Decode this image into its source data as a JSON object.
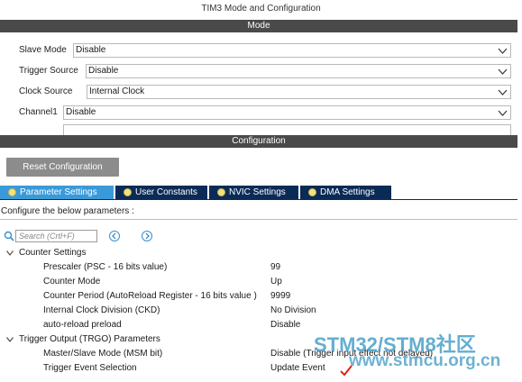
{
  "window": {
    "title": "TIM3 Mode and Configuration"
  },
  "mode_section": {
    "header": "Mode",
    "fields": [
      {
        "label": "Slave Mode",
        "value": "Disable"
      },
      {
        "label": "Trigger Source",
        "value": "Disable"
      },
      {
        "label": "Clock Source",
        "value": "Internal Clock"
      },
      {
        "label": "Channel1",
        "value": "Disable"
      }
    ]
  },
  "config_section": {
    "header": "Configuration",
    "reset_button": "Reset Configuration",
    "tabs": [
      {
        "label": "Parameter Settings",
        "active": true
      },
      {
        "label": "User Constants",
        "active": false
      },
      {
        "label": "NVIC Settings",
        "active": false
      },
      {
        "label": "DMA Settings",
        "active": false
      }
    ],
    "instruction": "Configure the below parameters :",
    "search_placeholder": "Search (Crtl+F)",
    "groups": [
      {
        "name": "Counter Settings",
        "params": [
          {
            "name": "Prescaler (PSC - 16 bits value)",
            "value": "99"
          },
          {
            "name": "Counter Mode",
            "value": "Up"
          },
          {
            "name": "Counter Period (AutoReload Register - 16 bits value )",
            "value": "9999"
          },
          {
            "name": "Internal Clock Division (CKD)",
            "value": "No Division"
          },
          {
            "name": "auto-reload preload",
            "value": "Disable"
          }
        ]
      },
      {
        "name": "Trigger Output (TRGO) Parameters",
        "params": [
          {
            "name": "Master/Slave Mode (MSM bit)",
            "value": "Disable (Trigger input effect not delayed)"
          },
          {
            "name": "Trigger Event Selection",
            "value": "Update Event"
          }
        ]
      }
    ]
  },
  "watermark": {
    "line1": "STM32/STM8社区",
    "line2": "www.stmcu.org.cn"
  },
  "colors": {
    "tab_active": "#3a9ad9",
    "tab_inactive": "#0b2b57",
    "section_bar": "#4a4a4a",
    "checkmark": "#e0201a"
  }
}
